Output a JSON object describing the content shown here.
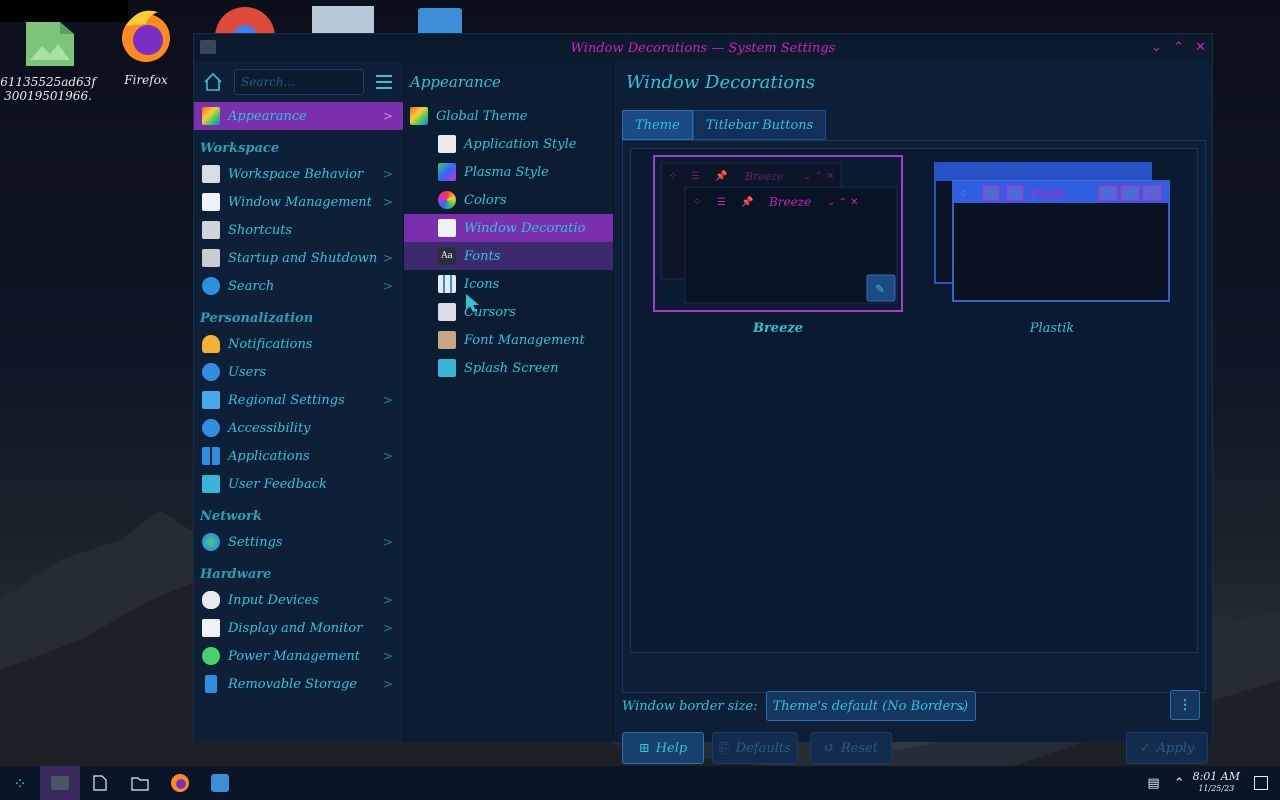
{
  "desktop": {
    "icons": [
      {
        "label_line1": "61135525ad63f",
        "label_line2": "30019501966."
      },
      {
        "label": "Firefox"
      }
    ]
  },
  "window": {
    "title": "Window Decorations — System Settings",
    "controls": {
      "minimize": "⌄",
      "maximize": "⌃",
      "close": "✕"
    }
  },
  "sidebar": {
    "search_placeholder": "Search...",
    "appearance": "Appearance",
    "sections": [
      {
        "heading": "Workspace",
        "items": [
          "Workspace Behavior",
          "Window Management",
          "Shortcuts",
          "Startup and Shutdown",
          "Search"
        ]
      },
      {
        "heading": "Personalization",
        "items": [
          "Notifications",
          "Users",
          "Regional Settings",
          "Accessibility",
          "Applications",
          "User Feedback"
        ]
      },
      {
        "heading": "Network",
        "items": [
          "Settings"
        ]
      },
      {
        "heading": "Hardware",
        "items": [
          "Input Devices",
          "Display and Monitor",
          "Power Management",
          "Removable Storage"
        ]
      }
    ]
  },
  "midcol": {
    "heading": "Appearance",
    "items": [
      "Global Theme",
      "Application Style",
      "Plasma Style",
      "Colors",
      "Window Decoratio",
      "Fonts",
      "Icons",
      "Cursors",
      "Font Management",
      "Splash Screen"
    ]
  },
  "main": {
    "title": "Window Decorations",
    "tabs": [
      "Theme",
      "Titlebar Buttons"
    ],
    "themes": [
      {
        "name": "Breeze",
        "preview_title": "Breeze"
      },
      {
        "name": "Plastik",
        "preview_title": "Plastik"
      }
    ],
    "border_label": "Window border size:",
    "border_value": "Theme's default (No Borders)",
    "buttons": {
      "help": "Help",
      "defaults": "Defaults",
      "reset": "Reset",
      "apply": "Apply"
    }
  },
  "taskbar": {
    "time": "8:01 AM",
    "date": "11/25/23"
  },
  "colors": {
    "accent_magenta": "#d41fbf",
    "text_cyan": "#2ec4d6",
    "selection_purple": "#7a2fae"
  }
}
